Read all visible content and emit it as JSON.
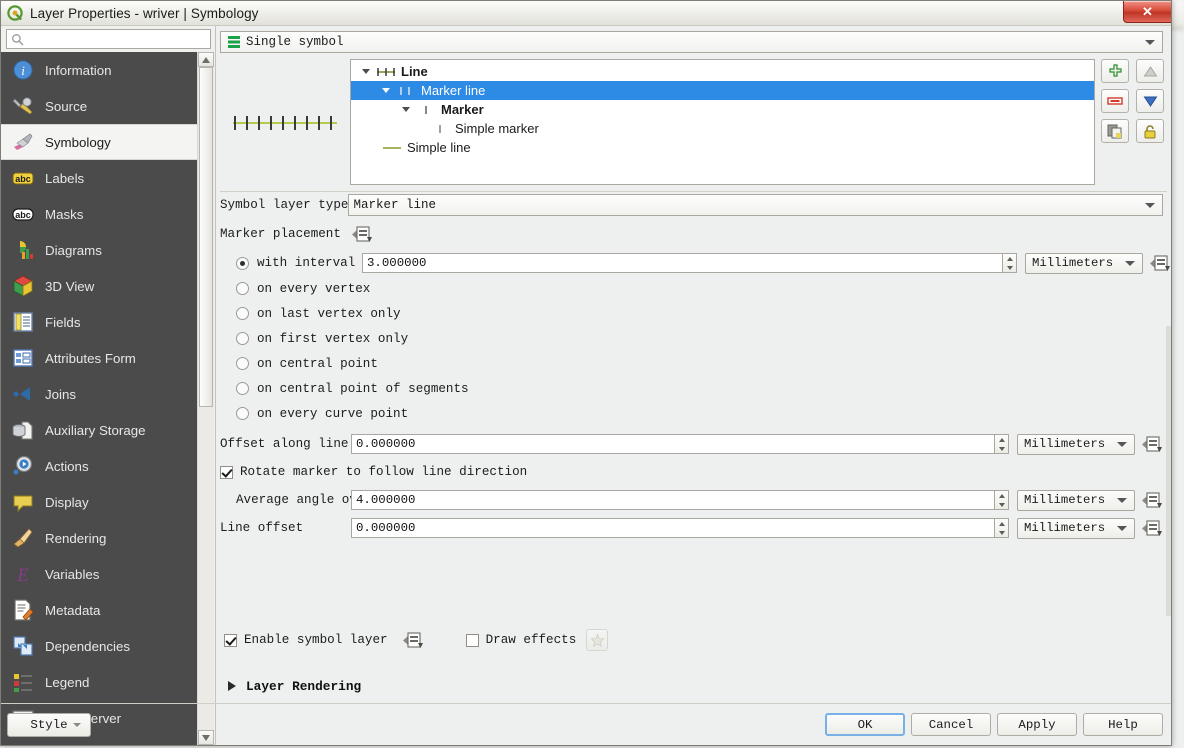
{
  "window": {
    "title": "Layer Properties - wriver | Symbology",
    "close_label": "✕",
    "logo_icon": "qgis-logo-icon"
  },
  "search": {
    "value": "",
    "placeholder": "",
    "icon": "search-icon"
  },
  "sidebar": {
    "items": [
      {
        "label": "Information",
        "icon": "information-icon",
        "selected": false
      },
      {
        "label": "Source",
        "icon": "source-icon",
        "selected": false
      },
      {
        "label": "Symbology",
        "icon": "symbology-brush-icon",
        "selected": true
      },
      {
        "label": "Labels",
        "icon": "labels-abc-icon",
        "selected": false
      },
      {
        "label": "Masks",
        "icon": "masks-abc-icon",
        "selected": false
      },
      {
        "label": "Diagrams",
        "icon": "diagrams-chart-icon",
        "selected": false
      },
      {
        "label": "3D View",
        "icon": "cube-3d-icon",
        "selected": false
      },
      {
        "label": "Fields",
        "icon": "fields-table-icon",
        "selected": false
      },
      {
        "label": "Attributes Form",
        "icon": "attributes-form-icon",
        "selected": false
      },
      {
        "label": "Joins",
        "icon": "joins-icon",
        "selected": false
      },
      {
        "label": "Auxiliary Storage",
        "icon": "auxiliary-storage-icon",
        "selected": false
      },
      {
        "label": "Actions",
        "icon": "actions-play-icon",
        "selected": false
      },
      {
        "label": "Display",
        "icon": "display-balloon-icon",
        "selected": false
      },
      {
        "label": "Rendering",
        "icon": "rendering-brush-icon",
        "selected": false
      },
      {
        "label": "Variables",
        "icon": "variables-epsilon-icon",
        "selected": false
      },
      {
        "label": "Metadata",
        "icon": "metadata-pencil-icon",
        "selected": false
      },
      {
        "label": "Dependencies",
        "icon": "dependencies-icon",
        "selected": false
      },
      {
        "label": "Legend",
        "icon": "legend-icon",
        "selected": false
      },
      {
        "label": "QGIS Server",
        "icon": "qgis-server-icon",
        "selected": false
      }
    ]
  },
  "renderer": {
    "label": "Single symbol",
    "icon": "single-symbol-icon"
  },
  "symbol_tree": {
    "preview_alt": "marker-line-preview",
    "rows": [
      {
        "label": "Line",
        "indent": 0,
        "bold": true,
        "selected": false,
        "expandable": true,
        "glyph": "line-glyph"
      },
      {
        "label": "Marker line",
        "indent": 1,
        "bold": false,
        "selected": true,
        "expandable": true,
        "glyph": "marker-line-glyph"
      },
      {
        "label": "Marker",
        "indent": 2,
        "bold": true,
        "selected": false,
        "expandable": true,
        "glyph": "marker-glyph"
      },
      {
        "label": "Simple marker",
        "indent": 3,
        "bold": false,
        "selected": false,
        "expandable": false,
        "glyph": "simple-marker-glyph"
      },
      {
        "label": "Simple line",
        "indent": 1,
        "bold": false,
        "selected": false,
        "expandable": false,
        "glyph": "simple-line-glyph"
      }
    ],
    "buttons": [
      {
        "name": "add-symbol-layer-button",
        "icon": "plus-icon"
      },
      {
        "name": "move-up-button",
        "icon": "arrow-up-icon"
      },
      {
        "name": "remove-symbol-layer-button",
        "icon": "minus-icon"
      },
      {
        "name": "move-down-button",
        "icon": "arrow-down-icon"
      },
      {
        "name": "duplicate-button",
        "icon": "copy-icon"
      },
      {
        "name": "lock-colors-button",
        "icon": "lock-icon"
      }
    ]
  },
  "symbol_layer_type": {
    "label": "Symbol layer type",
    "value": "Marker line"
  },
  "marker_placement": {
    "label": "Marker placement",
    "data_defined_icon": "data-defined-override-icon",
    "options": [
      {
        "label": "with interval",
        "selected": true
      },
      {
        "label": "on every vertex",
        "selected": false
      },
      {
        "label": "on last vertex only",
        "selected": false
      },
      {
        "label": "on first vertex only",
        "selected": false
      },
      {
        "label": "on central point",
        "selected": false
      },
      {
        "label": "on central point of segments",
        "selected": false
      },
      {
        "label": "on every curve point",
        "selected": false
      }
    ],
    "interval_value": "3.000000",
    "interval_unit": "Millimeters"
  },
  "offset_along_line": {
    "label": "Offset along line",
    "value": "0.000000",
    "unit": "Millimeters"
  },
  "rotate_marker": {
    "label": "Rotate marker to follow line direction",
    "checked": true
  },
  "average_angle": {
    "label": "Average angle over",
    "value": "4.000000",
    "unit": "Millimeters"
  },
  "line_offset": {
    "label": "Line offset",
    "value": "0.000000",
    "unit": "Millimeters"
  },
  "enable_symbol_layer": {
    "label": "Enable symbol layer",
    "checked": true,
    "data_defined_icon": "data-defined-override-icon"
  },
  "draw_effects": {
    "label": "Draw effects",
    "checked": false,
    "effects_icon": "effects-star-icon"
  },
  "layer_rendering": {
    "label": "Layer Rendering",
    "expanded": false
  },
  "footer": {
    "style_button": "Style",
    "buttons": [
      {
        "label": "OK",
        "default": true
      },
      {
        "label": "Cancel",
        "default": false
      },
      {
        "label": "Apply",
        "default": false
      },
      {
        "label": "Help",
        "default": false
      }
    ]
  },
  "colors": {
    "selection_blue": "#2d8ae5",
    "sidebar_bg": "#4b4b4b",
    "dialog_bg": "#eef0ef",
    "preview_line": "#b5c94a",
    "close_red": "#d84a38"
  }
}
